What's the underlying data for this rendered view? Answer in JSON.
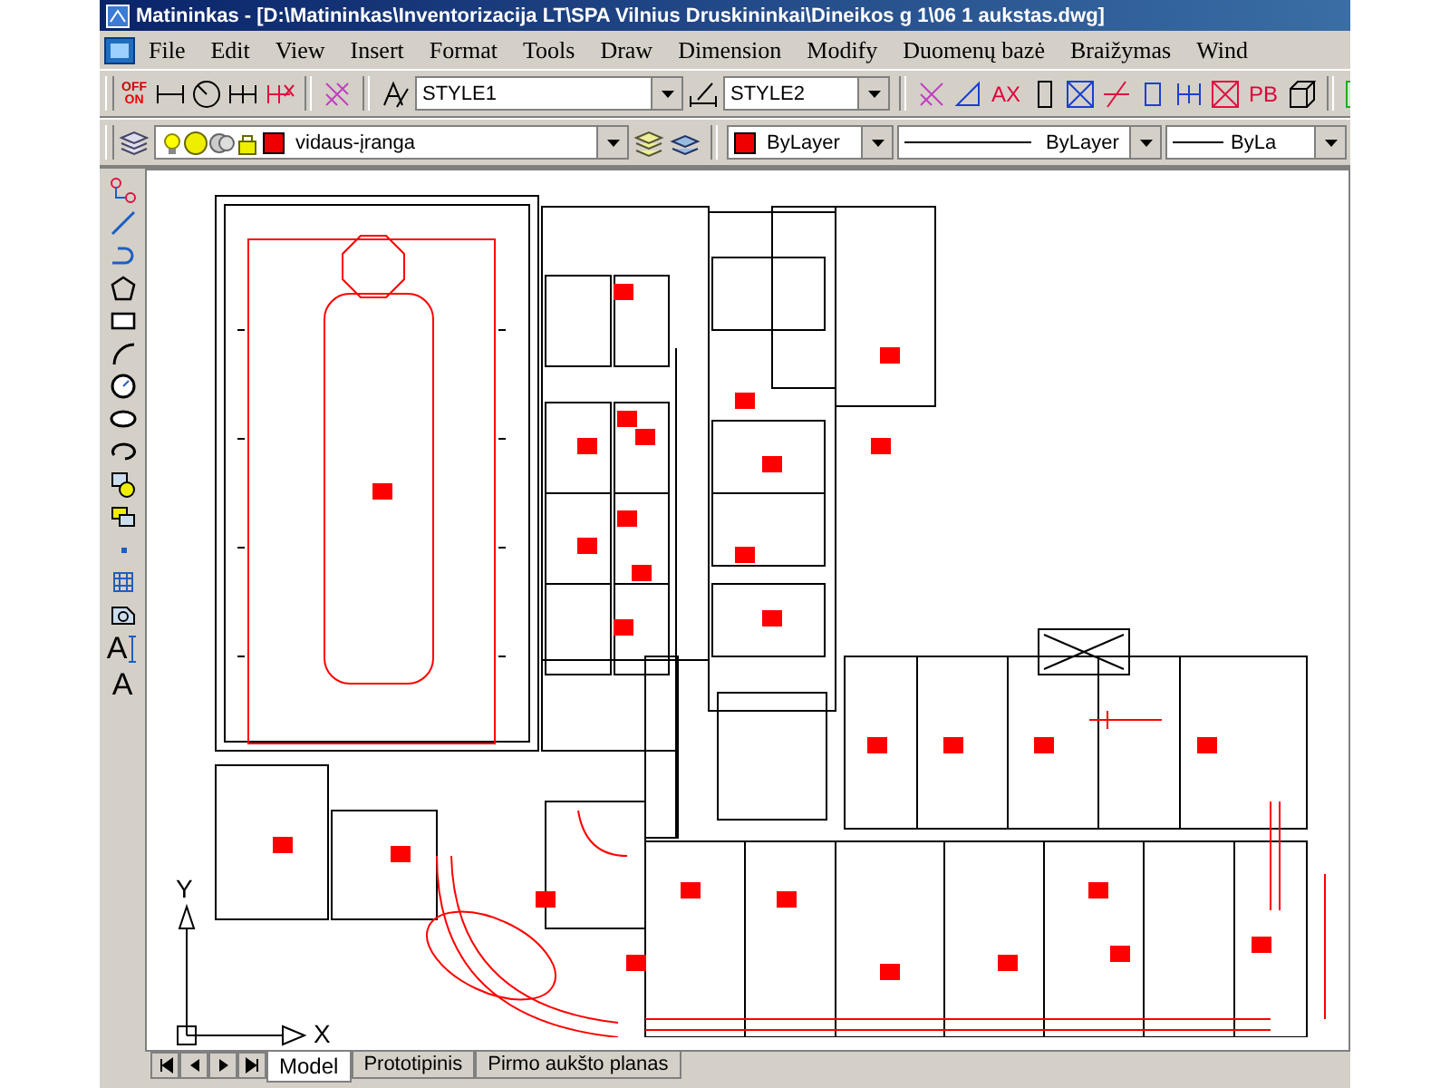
{
  "window": {
    "title": "Matininkas - [D:\\Matininkas\\Inventorizacija LT\\SPA Vilnius Druskininkai\\Dineikos g 1\\06 1 aukstas.dwg]"
  },
  "menu": [
    "File",
    "Edit",
    "View",
    "Insert",
    "Format",
    "Tools",
    "Draw",
    "Dimension",
    "Modify",
    "Duomenų bazė",
    "Braižymas",
    "Wind"
  ],
  "toolbar_1": {
    "glyphs": [
      "OFF",
      "ON",
      "AX",
      "PB"
    ],
    "style_dropdowns": [
      "STYLE1",
      "STYLE2"
    ]
  },
  "toolbar_2": {
    "layer": "vidaus-įranga",
    "color_setting": "ByLayer",
    "linetype": "ByLayer",
    "lineweight": "ByLa"
  },
  "draw_toolbar": {
    "text_glyphs": [
      "A",
      "A"
    ]
  },
  "ucs": {
    "x_label": "X",
    "y_label": "Y"
  },
  "layout_tabs": [
    {
      "label": "Model",
      "selected": true
    },
    {
      "label": "Prototipinis",
      "selected": false
    },
    {
      "label": "Pirmo aukšto planas",
      "selected": false
    }
  ]
}
